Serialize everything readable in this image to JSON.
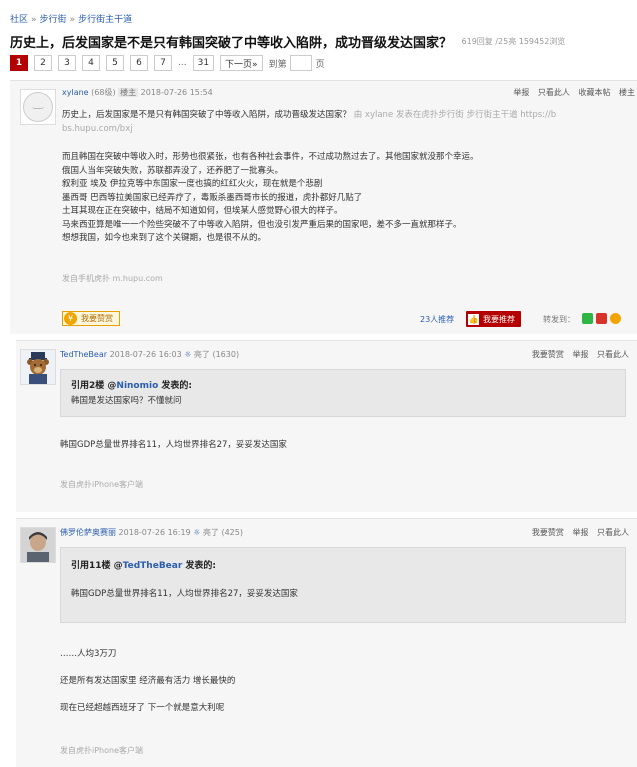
{
  "breadcrumb": {
    "items": [
      "社区",
      "步行街",
      "步行街主干道"
    ],
    "sep": "»"
  },
  "thread": {
    "title": "历史上，后发国家是不是只有韩国突破了中等收入陷阱，成功晋级发达国家？",
    "stats": "619回复 /25亮  159452浏览"
  },
  "pager": {
    "pages": [
      "1",
      "2",
      "3",
      "4",
      "5",
      "6",
      "7"
    ],
    "ellipsis": "...",
    "last": "31",
    "next": "下一页»",
    "jump_label": "到第",
    "page_suffix": "页"
  },
  "main_post": {
    "author": "xylane",
    "level": "(68级)",
    "badge": "楼主",
    "time": "2018-07-26 15:54",
    "actions": [
      "举报",
      "只看此人",
      "收藏本帖",
      "楼主"
    ],
    "intro": "历史上，后发国家是不是只有韩国突破了中等收入陷阱，成功晋级发达国家？",
    "intro_muted": " 由 xylane 发表在虎扑步行街 步行街主干道 https://b",
    "intro_muted2": "bs.hupu.com/bxj",
    "lines": [
      "而且韩国在突破中等收入时，形势也很紧张，也有各种社会事件，不过成功熬过去了。其他国家就没那个幸运。",
      "俄国人当年突破失败，苏联都弄没了，还养肥了一批寡头。",
      "叙利亚 埃及 伊拉克等中东国家一度也搞的红红火火，现在就是个悲剧",
      "墨西哥 巴西等拉美国家已经弄疗了，毒贩杀墨西哥市长的报道，虎扑都好几贴了",
      "土耳其现在正在突破中，结局不知道如何，但埃某人感觉野心很大的样子。",
      "马来西亚算是唯一一个险些突破不了中等收入陷阱，但也没引发严重后果的国家吧，差不多一直就那样子。",
      "想想我国，如今也来到了这个关键期，也是很不从的。"
    ],
    "source": "发自手机虎扑 m.hupu.com",
    "support_label": "我要赞赏",
    "rec_count": "23人推荐",
    "rec_button": "我要推荐",
    "share_label": "转发到："
  },
  "reply1": {
    "author": "TedTheBear",
    "time": "2018-07-26 16:03",
    "light_label": "亮了",
    "light_count": "(1630)",
    "actions": [
      "我要赞赏",
      "举报",
      "只看此人"
    ],
    "quote_head_prefix": "引用2楼 @",
    "quote_user": "Ninomio",
    "quote_head_suffix": " 发表的:",
    "quote_text": "韩国是发达国家吗？不懂就问",
    "body": "韩国GDP总量世界排名11，人均世界排名27，妥妥发达国家",
    "source": "发自虎扑iPhone客户端"
  },
  "reply2": {
    "author": "佛罗伦萨奥赛丽",
    "time": "2018-07-26 16:19",
    "light_label": "亮了",
    "light_count": "(425)",
    "actions": [
      "我要赞赏",
      "举报",
      "只看此人"
    ],
    "quote_head_prefix": "引用11楼 @",
    "quote_user": "TedTheBear",
    "quote_head_suffix": " 发表的:",
    "quote_text": "韩国GDP总量世界排名11，人均世界排名27，妥妥发达国家",
    "lines": [
      "……人均3万刀",
      "还是所有发达国家里 经济最有活力 增长最快的",
      "现在已经超越西班牙了 下一个就是意大利呢"
    ],
    "source": "发自虎扑iPhone客户端"
  },
  "colors": {
    "accent": "#b40000",
    "link": "#2a5db0",
    "post_bg": "#f6f6f6",
    "quote_bg": "#e8e8e8"
  }
}
